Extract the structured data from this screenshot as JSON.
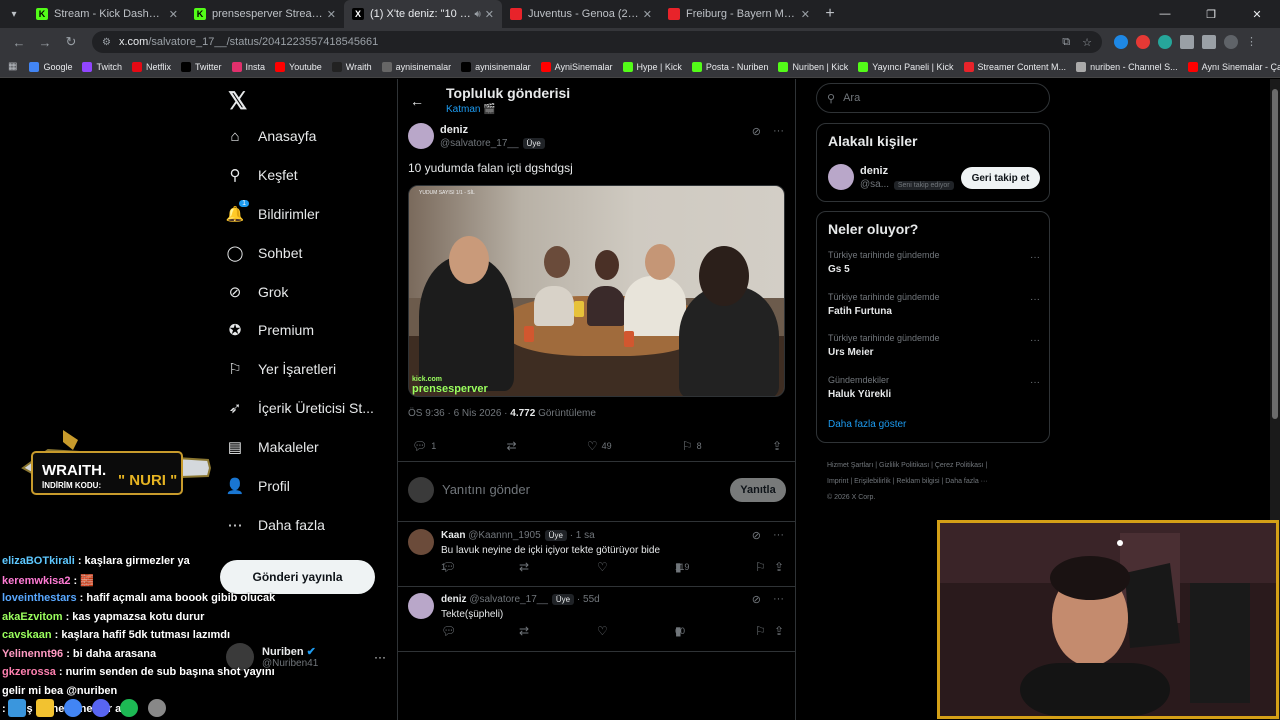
{
  "browser": {
    "tabs": [
      {
        "title": "Stream - Kick Dashboard",
        "color": "#53fc18",
        "glyph": "K",
        "active": false,
        "audio": false
      },
      {
        "title": "prensesperver Stream - Watch L",
        "color": "#53fc18",
        "glyph": "K",
        "active": false,
        "audio": false
      },
      {
        "title": "(1) X'te deniz: \"10 yudumda",
        "color": "#000000",
        "glyph": "X",
        "active": true,
        "audio": true
      },
      {
        "title": "Juventus - Genoa (2-0) - Maç Ö",
        "color": "#e8232a",
        "glyph": "▶",
        "active": false,
        "audio": false
      },
      {
        "title": "Freiburg - Bayern Münih | Bund",
        "color": "#e8232a",
        "glyph": "▶",
        "active": false,
        "audio": false
      }
    ],
    "url_host": "x.com",
    "url_path": "/salvatore_17__/status/2041223557418545661",
    "bookmarks": [
      {
        "label": "Google",
        "color": "#4285f4"
      },
      {
        "label": "Twitch",
        "color": "#9146ff"
      },
      {
        "label": "Netflix",
        "color": "#e50914"
      },
      {
        "label": "Twitter",
        "color": "#000000"
      },
      {
        "label": "Insta",
        "color": "#e1306c"
      },
      {
        "label": "Youtube",
        "color": "#ff0000"
      },
      {
        "label": "Wraith",
        "color": "#222222"
      },
      {
        "label": "aynisinemalar",
        "color": "#666666"
      },
      {
        "label": "aynisinemalar",
        "color": "#000000"
      },
      {
        "label": "AyniSinemalar",
        "color": "#ff0000"
      },
      {
        "label": "Hype | Kick",
        "color": "#53fc18"
      },
      {
        "label": "Posta - Nuriben",
        "color": "#53fc18"
      },
      {
        "label": "Nuriben | Kick",
        "color": "#53fc18"
      },
      {
        "label": "Yayıncı Paneli | Kick",
        "color": "#53fc18"
      },
      {
        "label": "Streamer Content M...",
        "color": "#e8232a"
      },
      {
        "label": "nuriben - Channel S...",
        "color": "#aaaaaa"
      },
      {
        "label": "Aynı Sinemalar - Ça...",
        "color": "#ff0000"
      }
    ]
  },
  "x": {
    "nav": [
      {
        "label": "Anasayfa",
        "icon": "home-icon",
        "glyph": "⌂"
      },
      {
        "label": "Keşfet",
        "icon": "search-icon",
        "glyph": "⚲"
      },
      {
        "label": "Bildirimler",
        "icon": "bell-icon",
        "glyph": "🔔",
        "badge": "1"
      },
      {
        "label": "Sohbet",
        "icon": "chat-icon",
        "glyph": "◯"
      },
      {
        "label": "Grok",
        "icon": "grok-icon",
        "glyph": "⊘"
      },
      {
        "label": "Premium",
        "icon": "premium-icon",
        "glyph": "✪"
      },
      {
        "label": "Yer İşaretleri",
        "icon": "bookmark-icon",
        "glyph": "⚐"
      },
      {
        "label": "İçerik Üreticisi St...",
        "icon": "rocket-icon",
        "glyph": "➶"
      },
      {
        "label": "Makaleler",
        "icon": "article-icon",
        "glyph": "▤"
      },
      {
        "label": "Profil",
        "icon": "profile-icon",
        "glyph": "👤"
      },
      {
        "label": "Daha fazla",
        "icon": "more-icon",
        "glyph": "⋯"
      }
    ],
    "post_button": "Gönderi yayınla",
    "account": {
      "name": "Nuriben",
      "handle": "@Nuriben41"
    },
    "header": {
      "title": "Topluluk gönderisi",
      "subtitle": "Katman 🎬"
    },
    "post": {
      "name": "deniz",
      "handle": "@salvatore_17__",
      "member_badge": "Üye",
      "text": "10 yudumda falan içti dgshdgsj",
      "image_watermark_top": "YUDUM SAYISI 1/1 - SİL",
      "image_watermark_kick": "kick.com",
      "image_watermark_name": "prensesperver",
      "time": "ÖS 9:36 · 6 Nis 2026 · ",
      "views": "4.772",
      "views_label": " Görüntüleme",
      "replies": "1",
      "likes": "49",
      "bookmarks": "8"
    },
    "reply_box": {
      "placeholder": "Yanıtını gönder",
      "button": "Yanıtla"
    },
    "replies": [
      {
        "name": "Kaan",
        "handle": "@Kaannn_1905",
        "badge": "Üye",
        "time": "· 1 sa",
        "text": "Bu lavuk neyine de içki içiyor  tekte götürüyor bide",
        "replies": "1",
        "views": "119",
        "color": "#6b4b3a"
      },
      {
        "name": "deniz",
        "handle": "@salvatore_17__",
        "badge": "Üye",
        "time": "· 55d",
        "text": "Tekte(şüpheli)",
        "replies": "",
        "views": "60",
        "color": "#b9a7c9"
      }
    ],
    "search_placeholder": "Ara",
    "related": {
      "title": "Alakalı kişiler",
      "name": "deniz",
      "handle": "@sa...",
      "follows_you": "Seni takip ediyor",
      "button": "Geri takip et"
    },
    "trends": {
      "title": "Neler oluyor?",
      "items": [
        {
          "context": "Türkiye tarihinde gündemde",
          "name": "Gs 5"
        },
        {
          "context": "Türkiye tarihinde gündemde",
          "name": "Fatih Furtuna"
        },
        {
          "context": "Türkiye tarihinde gündemde",
          "name": "Urs Meier"
        },
        {
          "context": "Gündemdekiler",
          "name": "Haluk Yürekli"
        }
      ],
      "show_more": "Daha fazla göster"
    },
    "footer": {
      "line1": "Hizmet Şartları  |  Gizlilik Politikası  |  Çerez Politikası  |",
      "line2": "Imprint  |  Erişilebilirlik  |  Reklam bilgisi  |  Daha fazla ···",
      "line3": "© 2026 X Corp."
    }
  },
  "overlay": {
    "wraith_brand": "WRAITH.",
    "wraith_code_label": "İNDİRİM KODU:",
    "wraith_code": "\" NURI \"",
    "chat": [
      {
        "user": "elizaBOTkirali",
        "color": "#5ec8ff",
        "msg": " : kaşlara girmezler ya"
      },
      {
        "user": "keremwkisa2",
        "color": "#ff7bd5",
        "msg": " : 🧱"
      },
      {
        "user": "loveinthestars",
        "color": "#59a8ff",
        "msg": " : hafif açmalı ama boook gibib olucak"
      },
      {
        "user": "akaEzvitom",
        "color": "#9bff5e",
        "msg": " : kas yapmazsa kotu durur"
      },
      {
        "user": "cavskaan",
        "color": "#9bff5e",
        "msg": " : kaşlara hafif 5dk tutması lazımdı"
      },
      {
        "user": "Yelinennt96",
        "color": "#ff9ac2",
        "msg": " : bi daha arasana"
      },
      {
        "user": "gkzerossa",
        "color": "#ff80b0",
        "msg": " : nurim senden de sub başına shot yayını"
      },
      {
        "user": "gelir mi bea",
        "color": "#ffffff",
        "msg": " @nuriben"
      },
      {
        "user": "",
        "color": "#ff5ec4",
        "msg": "  : Froş da ne çene var aw"
      }
    ]
  }
}
